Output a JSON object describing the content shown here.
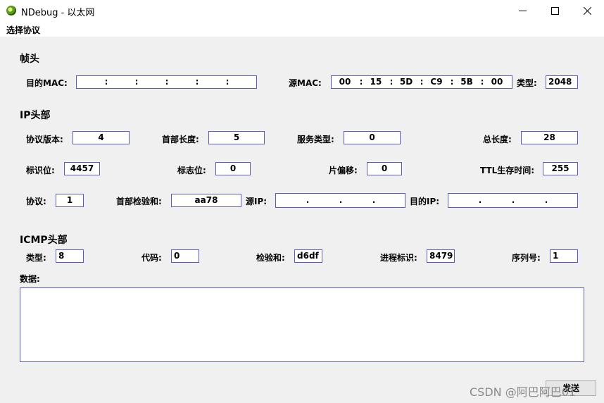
{
  "window": {
    "title": "NDebug - 以太网",
    "controls": {
      "minimize": "—",
      "maximize": "☐",
      "close": "✕"
    }
  },
  "menu": {
    "items": [
      "选择协议"
    ]
  },
  "frame_header": {
    "title": "帧头",
    "dst_mac_label": "目的MAC:",
    "dst_mac": [
      "",
      "",
      "",
      "",
      "",
      ""
    ],
    "src_mac_label": "源MAC:",
    "src_mac": [
      "00",
      "15",
      "5D",
      "C9",
      "5B",
      "00"
    ],
    "type_label": "类型:",
    "type_value": "2048",
    "mac_separator": ":"
  },
  "ip_header": {
    "title": "IP头部",
    "version_label": "协议版本:",
    "version": "4",
    "header_length_label": "首部长度:",
    "header_length": "5",
    "service_type_label": "服务类型:",
    "service_type": "0",
    "total_length_label": "总长度:",
    "total_length": "28",
    "identification_label": "标识位:",
    "identification": "4457",
    "flags_label": "标志位:",
    "flags": "0",
    "fragment_offset_label": "片偏移:",
    "fragment_offset": "0",
    "ttl_label": "TTL生存时间:",
    "ttl": "255",
    "protocol_label": "协议:",
    "protocol": "1",
    "checksum_label": "首部检验和:",
    "checksum": "aa78",
    "src_ip_label": "源IP:",
    "src_ip": [
      "",
      "",
      "",
      ""
    ],
    "dst_ip_label": "目的IP:",
    "dst_ip": [
      "",
      "",
      "",
      ""
    ],
    "ip_separator": "."
  },
  "icmp_header": {
    "title": "ICMP头部",
    "type_label": "类型:",
    "type": "8",
    "code_label": "代码:",
    "code": "0",
    "checksum_label": "检验和:",
    "checksum": "d6df",
    "process_id_label": "进程标识:",
    "process_id": "8479",
    "sequence_label": "序列号:",
    "sequence": "1"
  },
  "data_section": {
    "label": "数据:",
    "content": ""
  },
  "send_button": {
    "label": "发送"
  },
  "watermark": "CSDN @阿巴阿巴01"
}
